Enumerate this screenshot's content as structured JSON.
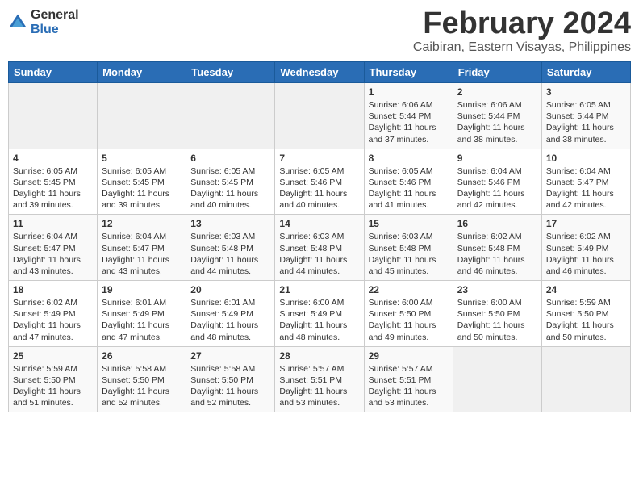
{
  "logo": {
    "general": "General",
    "blue": "Blue"
  },
  "title": {
    "month_year": "February 2024",
    "location": "Caibiran, Eastern Visayas, Philippines"
  },
  "headers": [
    "Sunday",
    "Monday",
    "Tuesday",
    "Wednesday",
    "Thursday",
    "Friday",
    "Saturday"
  ],
  "weeks": [
    [
      {
        "day": "",
        "info": ""
      },
      {
        "day": "",
        "info": ""
      },
      {
        "day": "",
        "info": ""
      },
      {
        "day": "",
        "info": ""
      },
      {
        "day": "1",
        "info": "Sunrise: 6:06 AM\nSunset: 5:44 PM\nDaylight: 11 hours\nand 37 minutes."
      },
      {
        "day": "2",
        "info": "Sunrise: 6:06 AM\nSunset: 5:44 PM\nDaylight: 11 hours\nand 38 minutes."
      },
      {
        "day": "3",
        "info": "Sunrise: 6:05 AM\nSunset: 5:44 PM\nDaylight: 11 hours\nand 38 minutes."
      }
    ],
    [
      {
        "day": "4",
        "info": "Sunrise: 6:05 AM\nSunset: 5:45 PM\nDaylight: 11 hours\nand 39 minutes."
      },
      {
        "day": "5",
        "info": "Sunrise: 6:05 AM\nSunset: 5:45 PM\nDaylight: 11 hours\nand 39 minutes."
      },
      {
        "day": "6",
        "info": "Sunrise: 6:05 AM\nSunset: 5:45 PM\nDaylight: 11 hours\nand 40 minutes."
      },
      {
        "day": "7",
        "info": "Sunrise: 6:05 AM\nSunset: 5:46 PM\nDaylight: 11 hours\nand 40 minutes."
      },
      {
        "day": "8",
        "info": "Sunrise: 6:05 AM\nSunset: 5:46 PM\nDaylight: 11 hours\nand 41 minutes."
      },
      {
        "day": "9",
        "info": "Sunrise: 6:04 AM\nSunset: 5:46 PM\nDaylight: 11 hours\nand 42 minutes."
      },
      {
        "day": "10",
        "info": "Sunrise: 6:04 AM\nSunset: 5:47 PM\nDaylight: 11 hours\nand 42 minutes."
      }
    ],
    [
      {
        "day": "11",
        "info": "Sunrise: 6:04 AM\nSunset: 5:47 PM\nDaylight: 11 hours\nand 43 minutes."
      },
      {
        "day": "12",
        "info": "Sunrise: 6:04 AM\nSunset: 5:47 PM\nDaylight: 11 hours\nand 43 minutes."
      },
      {
        "day": "13",
        "info": "Sunrise: 6:03 AM\nSunset: 5:48 PM\nDaylight: 11 hours\nand 44 minutes."
      },
      {
        "day": "14",
        "info": "Sunrise: 6:03 AM\nSunset: 5:48 PM\nDaylight: 11 hours\nand 44 minutes."
      },
      {
        "day": "15",
        "info": "Sunrise: 6:03 AM\nSunset: 5:48 PM\nDaylight: 11 hours\nand 45 minutes."
      },
      {
        "day": "16",
        "info": "Sunrise: 6:02 AM\nSunset: 5:48 PM\nDaylight: 11 hours\nand 46 minutes."
      },
      {
        "day": "17",
        "info": "Sunrise: 6:02 AM\nSunset: 5:49 PM\nDaylight: 11 hours\nand 46 minutes."
      }
    ],
    [
      {
        "day": "18",
        "info": "Sunrise: 6:02 AM\nSunset: 5:49 PM\nDaylight: 11 hours\nand 47 minutes."
      },
      {
        "day": "19",
        "info": "Sunrise: 6:01 AM\nSunset: 5:49 PM\nDaylight: 11 hours\nand 47 minutes."
      },
      {
        "day": "20",
        "info": "Sunrise: 6:01 AM\nSunset: 5:49 PM\nDaylight: 11 hours\nand 48 minutes."
      },
      {
        "day": "21",
        "info": "Sunrise: 6:00 AM\nSunset: 5:49 PM\nDaylight: 11 hours\nand 48 minutes."
      },
      {
        "day": "22",
        "info": "Sunrise: 6:00 AM\nSunset: 5:50 PM\nDaylight: 11 hours\nand 49 minutes."
      },
      {
        "day": "23",
        "info": "Sunrise: 6:00 AM\nSunset: 5:50 PM\nDaylight: 11 hours\nand 50 minutes."
      },
      {
        "day": "24",
        "info": "Sunrise: 5:59 AM\nSunset: 5:50 PM\nDaylight: 11 hours\nand 50 minutes."
      }
    ],
    [
      {
        "day": "25",
        "info": "Sunrise: 5:59 AM\nSunset: 5:50 PM\nDaylight: 11 hours\nand 51 minutes."
      },
      {
        "day": "26",
        "info": "Sunrise: 5:58 AM\nSunset: 5:50 PM\nDaylight: 11 hours\nand 52 minutes."
      },
      {
        "day": "27",
        "info": "Sunrise: 5:58 AM\nSunset: 5:50 PM\nDaylight: 11 hours\nand 52 minutes."
      },
      {
        "day": "28",
        "info": "Sunrise: 5:57 AM\nSunset: 5:51 PM\nDaylight: 11 hours\nand 53 minutes."
      },
      {
        "day": "29",
        "info": "Sunrise: 5:57 AM\nSunset: 5:51 PM\nDaylight: 11 hours\nand 53 minutes."
      },
      {
        "day": "",
        "info": ""
      },
      {
        "day": "",
        "info": ""
      }
    ]
  ]
}
